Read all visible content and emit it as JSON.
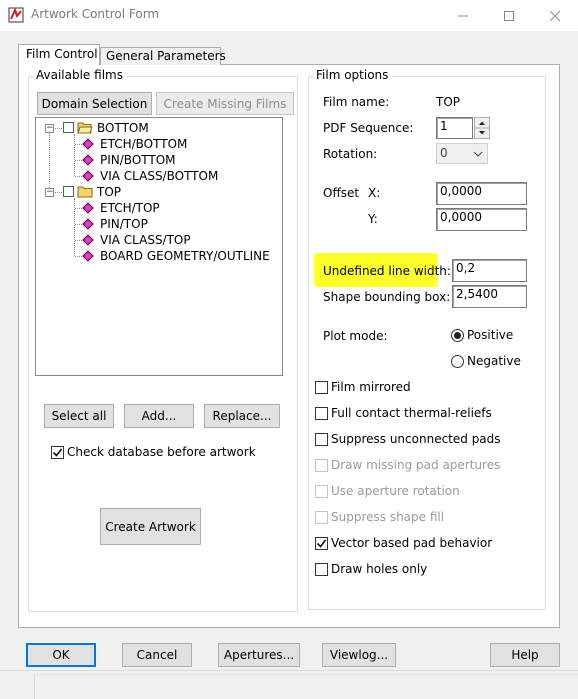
{
  "window": {
    "title": "Artwork Control Form"
  },
  "tabs": [
    {
      "label": "Film Control",
      "active": true
    },
    {
      "label": "General Parameters",
      "active": false
    }
  ],
  "available_films": {
    "legend": "Available films",
    "domain_selection_label": "Domain Selection",
    "create_missing_label": "Create Missing Films",
    "tree": [
      {
        "label": "BOTTOM",
        "expanded": true,
        "children": [
          "ETCH/BOTTOM",
          "PIN/BOTTOM",
          "VIA CLASS/BOTTOM"
        ]
      },
      {
        "label": "TOP",
        "expanded": true,
        "children": [
          "ETCH/TOP",
          "PIN/TOP",
          "VIA CLASS/TOP",
          "BOARD GEOMETRY/OUTLINE"
        ]
      }
    ],
    "select_all_label": "Select all",
    "add_label": "Add...",
    "replace_label": "Replace...",
    "check_db_label": "Check database before artwork",
    "check_db_checked": true,
    "create_artwork_label": "Create Artwork"
  },
  "film_options": {
    "legend": "Film options",
    "film_name_label": "Film name:",
    "film_name_value": "TOP",
    "pdf_sequence_label": "PDF Sequence:",
    "pdf_sequence_value": "1",
    "rotation_label": "Rotation:",
    "rotation_value": "0",
    "offset_label": "Offset",
    "offset_x_label": "X:",
    "offset_x_value": "0,0000",
    "offset_y_label": "Y:",
    "offset_y_value": "0,0000",
    "undefined_line_width_label": "Undefined line width:",
    "undefined_line_width_value": "0,2",
    "shape_bbox_label": "Shape bounding box:",
    "shape_bbox_value": "2,5400",
    "plot_mode_label": "Plot mode:",
    "plot_mode_positive": "Positive",
    "plot_mode_negative": "Negative",
    "plot_mode_selected": "Positive",
    "options": [
      {
        "label": "Film mirrored",
        "checked": false,
        "enabled": true
      },
      {
        "label": "Full contact thermal-reliefs",
        "checked": false,
        "enabled": true
      },
      {
        "label": "Suppress unconnected pads",
        "checked": false,
        "enabled": true
      },
      {
        "label": "Draw missing pad apertures",
        "checked": false,
        "enabled": false
      },
      {
        "label": "Use aperture rotation",
        "checked": false,
        "enabled": false
      },
      {
        "label": "Suppress shape fill",
        "checked": false,
        "enabled": false
      },
      {
        "label": "Vector based pad behavior",
        "checked": true,
        "enabled": true
      },
      {
        "label": "Draw holes only",
        "checked": false,
        "enabled": true
      }
    ]
  },
  "footer": {
    "ok_label": "OK",
    "cancel_label": "Cancel",
    "apertures_label": "Apertures...",
    "viewlog_label": "Viewlog...",
    "help_label": "Help"
  },
  "colors": {
    "highlight": "#ffff2a",
    "tree_leaf_icon": "#e040c0",
    "folder_icon": "#f4d46a"
  }
}
